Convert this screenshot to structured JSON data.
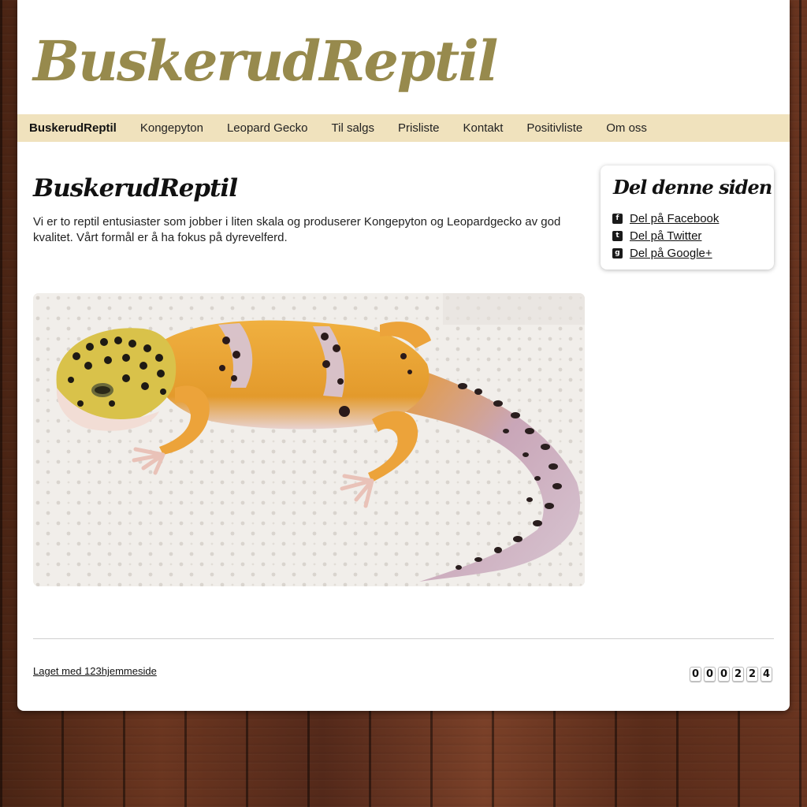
{
  "site": {
    "logo": "BuskerudReptil"
  },
  "nav": {
    "items": [
      {
        "label": "BuskerudReptil"
      },
      {
        "label": "Kongepyton"
      },
      {
        "label": "Leopard Gecko"
      },
      {
        "label": "Til salgs"
      },
      {
        "label": "Prisliste"
      },
      {
        "label": "Kontakt"
      },
      {
        "label": "Positivliste"
      },
      {
        "label": "Om oss"
      }
    ]
  },
  "main": {
    "title": "BuskerudReptil",
    "intro": "Vi er to reptil entusiaster som jobber i liten skala og produserer Kongepyton og Leopardgecko av god kvalitet. Vårt formål er å ha fokus på dyrevelferd."
  },
  "share": {
    "title": "Del denne siden",
    "items": [
      {
        "label": "Del på Facebook",
        "icon": "facebook-icon"
      },
      {
        "label": "Del på Twitter",
        "icon": "twitter-icon"
      },
      {
        "label": "Del på Google+",
        "icon": "google-plus-icon"
      }
    ]
  },
  "footer": {
    "credit": "Laget med 123hjemmeside",
    "counter": [
      "0",
      "0",
      "0",
      "2",
      "2",
      "4"
    ]
  },
  "colors": {
    "logo": "#978a4d",
    "nav_bg": "#f0e2bd"
  }
}
